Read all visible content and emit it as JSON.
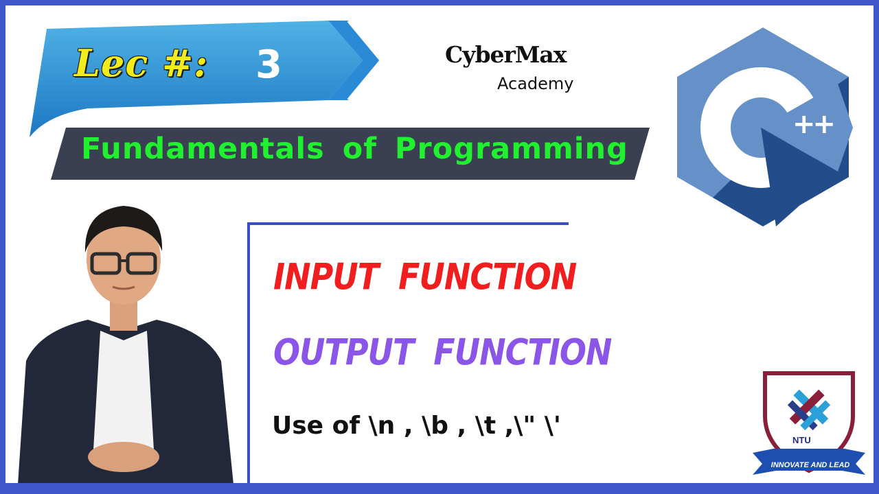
{
  "lecture": {
    "prefix": "Lec #:",
    "number": "3"
  },
  "course": {
    "title": "Fundamentals of Programming"
  },
  "academy": {
    "line1": "CyberMax",
    "line2": "Academy"
  },
  "topics": {
    "input": "INPUT FUNCTION",
    "output": "OUTPUT FUNCTION",
    "escapes": "Use of  \\n , \\b , \\t ,\\\" \\'"
  },
  "cpp_logo": {
    "plus": "++"
  },
  "ntu": {
    "name": "NTU",
    "motto": "INNOVATE AND LEAD"
  },
  "colors": {
    "frame": "#3f57c9",
    "lec_text": "#f3ec1c",
    "course_text": "#20f030",
    "input_text": "#f01e1e",
    "output_text": "#8b55e8",
    "cpp_light": "#6590c8",
    "cpp_dark": "#234c8a"
  },
  "icons": [
    "cpp-logo-icon",
    "ntu-shield-icon",
    "presenter-photo"
  ]
}
